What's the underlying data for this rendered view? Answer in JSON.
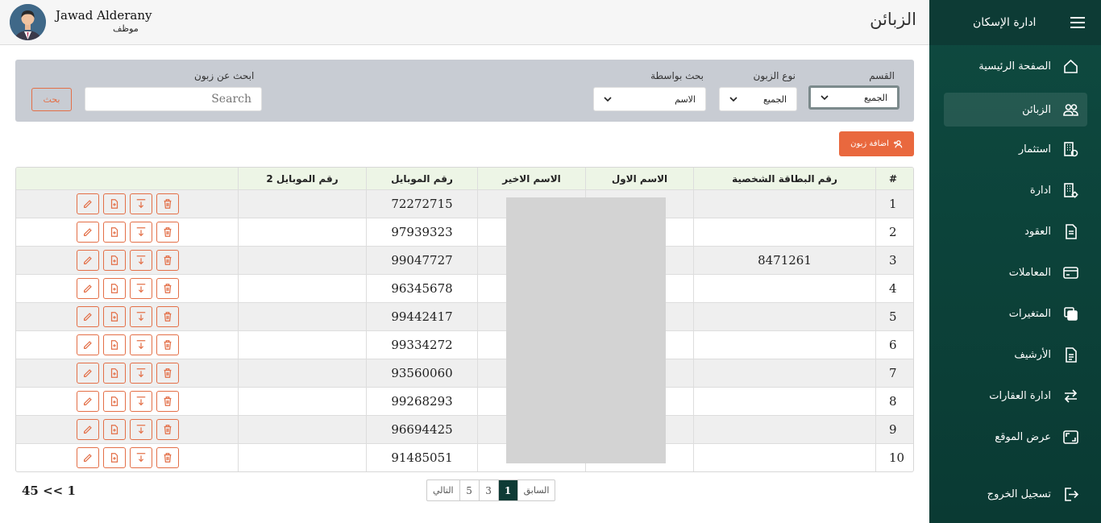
{
  "sidebar": {
    "title": "ادارة الإسكان",
    "items": [
      {
        "label": "الصفحة الرئيسية",
        "icon": "home-icon"
      },
      {
        "label": "الزبائن",
        "icon": "users-icon"
      },
      {
        "label": "استثمار",
        "icon": "building-icon"
      },
      {
        "label": "ادارة",
        "icon": "building-settings-icon"
      },
      {
        "label": "العقود",
        "icon": "document-icon"
      },
      {
        "label": "المعاملات",
        "icon": "card-icon"
      },
      {
        "label": "المتغيرات",
        "icon": "squares-icon"
      },
      {
        "label": "الأرشيف",
        "icon": "archive-icon"
      },
      {
        "label": "ادارة العقارات",
        "icon": "swap-icon"
      },
      {
        "label": "عرض الموقع",
        "icon": "screen-icon"
      },
      {
        "label": "تسجيل الخروج",
        "icon": "logout-icon"
      }
    ]
  },
  "header": {
    "page_title": "الزبائن",
    "user_name": "Jawad Alderany",
    "user_role": "موظف"
  },
  "filters": {
    "section_label": "القسم",
    "section_value": "الجميع",
    "customer_type_label": "نوع الزبون",
    "customer_type_value": "الجميع",
    "search_by_label": "بحث بواسطة",
    "search_by_value": "الاسم",
    "search_label": "ابحث عن زبون",
    "search_placeholder": "Search",
    "search_button": "بحث"
  },
  "add_customer_button": "اضافة زبون",
  "table": {
    "headers": {
      "num": "#",
      "civil_id": "رقم البطاقة الشخصية",
      "first": "الاسم الاول",
      "last": "الاسم الاخير",
      "mobile": "رقم الموبايل",
      "mobile2": "رقم الموبايل 2"
    },
    "rows": [
      {
        "num": "1",
        "civil_id": "",
        "mobile": "72272715",
        "mobile2": ""
      },
      {
        "num": "2",
        "civil_id": "",
        "mobile": "97939323",
        "mobile2": ""
      },
      {
        "num": "3",
        "civil_id": "8471261",
        "mobile": "99047727",
        "mobile2": ""
      },
      {
        "num": "4",
        "civil_id": "",
        "mobile": "96345678",
        "mobile2": ""
      },
      {
        "num": "5",
        "civil_id": "",
        "mobile": "99442417",
        "mobile2": ""
      },
      {
        "num": "6",
        "civil_id": "",
        "mobile": "99334272",
        "mobile2": ""
      },
      {
        "num": "7",
        "civil_id": "",
        "mobile": "93560060",
        "mobile2": ""
      },
      {
        "num": "8",
        "civil_id": "",
        "mobile": "99268293",
        "mobile2": ""
      },
      {
        "num": "9",
        "civil_id": "",
        "mobile": "96694425",
        "mobile2": ""
      },
      {
        "num": "10",
        "civil_id": "",
        "mobile": "91485051",
        "mobile2": ""
      }
    ]
  },
  "pagination": {
    "prev": "السابق",
    "pages": [
      "1",
      "3",
      "5"
    ],
    "current": "1",
    "next": "التالي",
    "total": "45 << 1"
  },
  "colors": {
    "sidebar": "#0e4a40",
    "accent": "#e9683e",
    "panel": "#c8ccd3"
  }
}
